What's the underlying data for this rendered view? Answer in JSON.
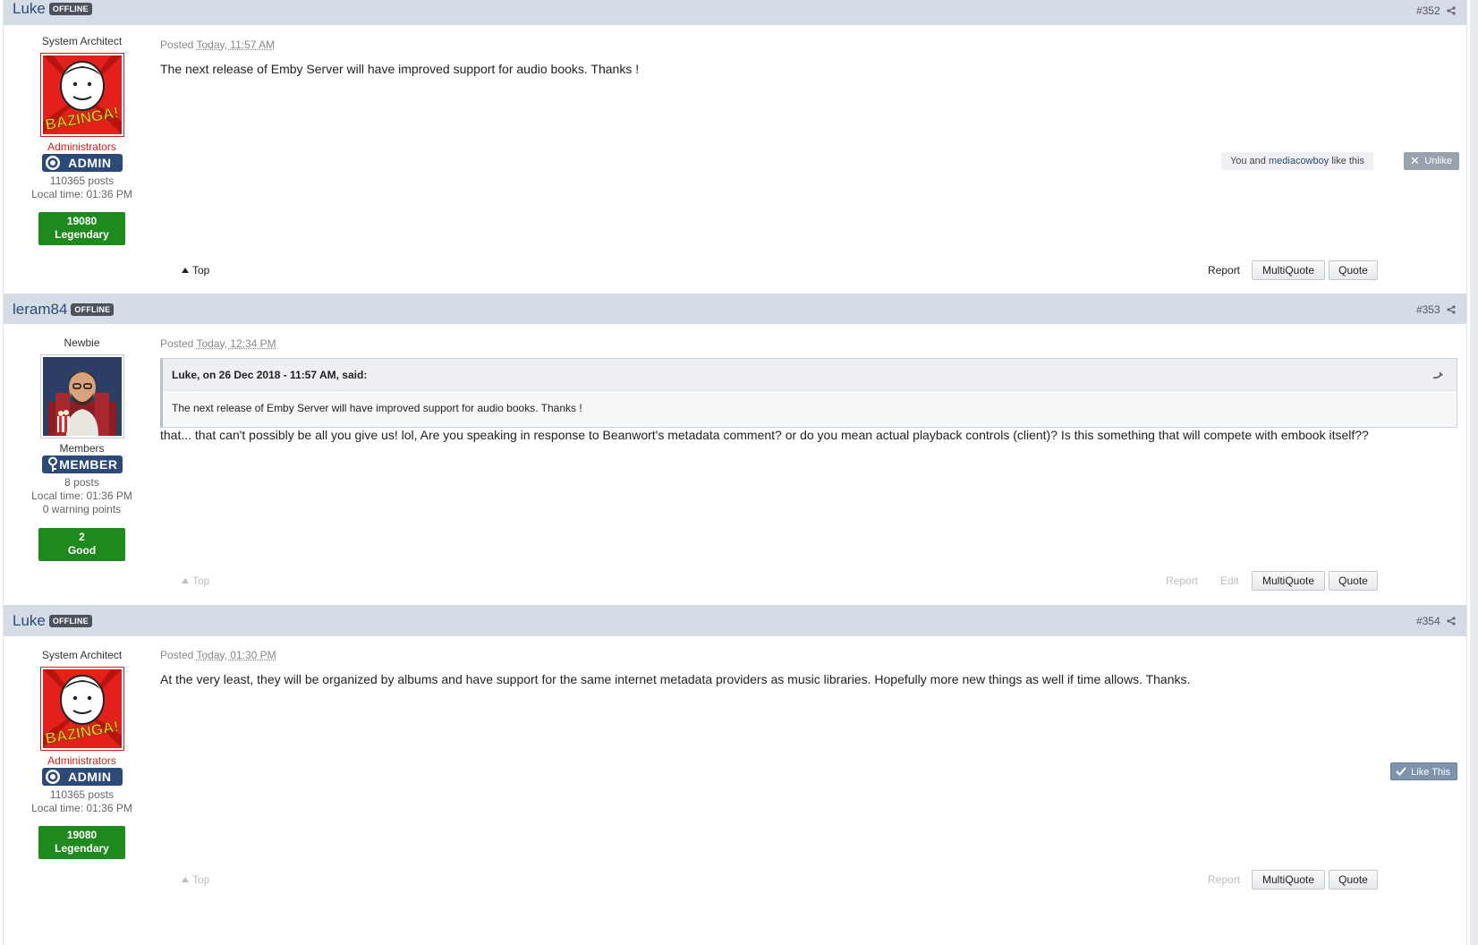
{
  "posts": [
    {
      "author": "Luke",
      "status_badge": "OFFLINE",
      "post_number": "#352",
      "user_title": "System Architect",
      "group": "Administrators",
      "rank_badge": "ADMIN",
      "posts_count": "110365 posts",
      "local_time": "Local time: 01:36 PM",
      "reputation_value": "19080",
      "reputation_label": "Legendary",
      "posted_label": "Posted",
      "posted_time": "Today, 11:57 AM",
      "content": "The next release of Emby Server will have improved support for audio books. Thanks !",
      "likes_prefix": "You and",
      "likes_user": "mediacowboy",
      "likes_suffix": "like this",
      "unlike_label": "Unlike",
      "top_label": "Top",
      "report_label": "Report",
      "multiquote_label": "MultiQuote",
      "quote_label": "Quote"
    },
    {
      "author": "leram84",
      "status_badge": "OFFLINE",
      "post_number": "#353",
      "user_title": "Newbie",
      "group": "Members",
      "rank_badge": "MEMBER",
      "posts_count": "8 posts",
      "local_time": "Local time: 01:36 PM",
      "warning_points": "0 warning points",
      "reputation_value": "2",
      "reputation_label": "Good",
      "posted_label": "Posted",
      "posted_time": "Today, 12:34 PM",
      "quote_header": "Luke, on 26 Dec 2018 - 11:57 AM, said:",
      "quote_text": "The next release of Emby Server will have improved support for audio books. Thanks !",
      "content": "that... that can't possibly be all you give us! lol, Are you speaking in response to Beanwort's metadata comment? or do you mean actual playback controls (client)? Is this something that will compete with embook itself??",
      "top_label": "Top",
      "report_label": "Report",
      "edit_label": "Edit",
      "multiquote_label": "MultiQuote",
      "quote_label": "Quote"
    },
    {
      "author": "Luke",
      "status_badge": "OFFLINE",
      "post_number": "#354",
      "user_title": "System Architect",
      "group": "Administrators",
      "rank_badge": "ADMIN",
      "posts_count": "110365 posts",
      "local_time": "Local time: 01:36 PM",
      "reputation_value": "19080",
      "reputation_label": "Legendary",
      "posted_label": "Posted",
      "posted_time": "Today, 01:30 PM",
      "content": "At the very least, they will be organized by albums and have support for the same internet metadata providers as music libraries. Hopefully more new things as well if time allows. Thanks.",
      "like_label": "Like This",
      "top_label": "Top",
      "report_label": "Report",
      "multiquote_label": "MultiQuote",
      "quote_label": "Quote"
    }
  ],
  "colors": {
    "header_bg": "#d5dce6",
    "author_link": "#2d4a78",
    "admin_group": "#d61b1b",
    "reputation_green": "#1e8a1e",
    "rank_badge_bg": "#2b4a78"
  },
  "icons": [
    "share-icon",
    "admin-gear-icon",
    "member-key-icon",
    "quote-arrow-icon",
    "close-x-icon",
    "checkmark-icon",
    "up-triangle-icon"
  ]
}
